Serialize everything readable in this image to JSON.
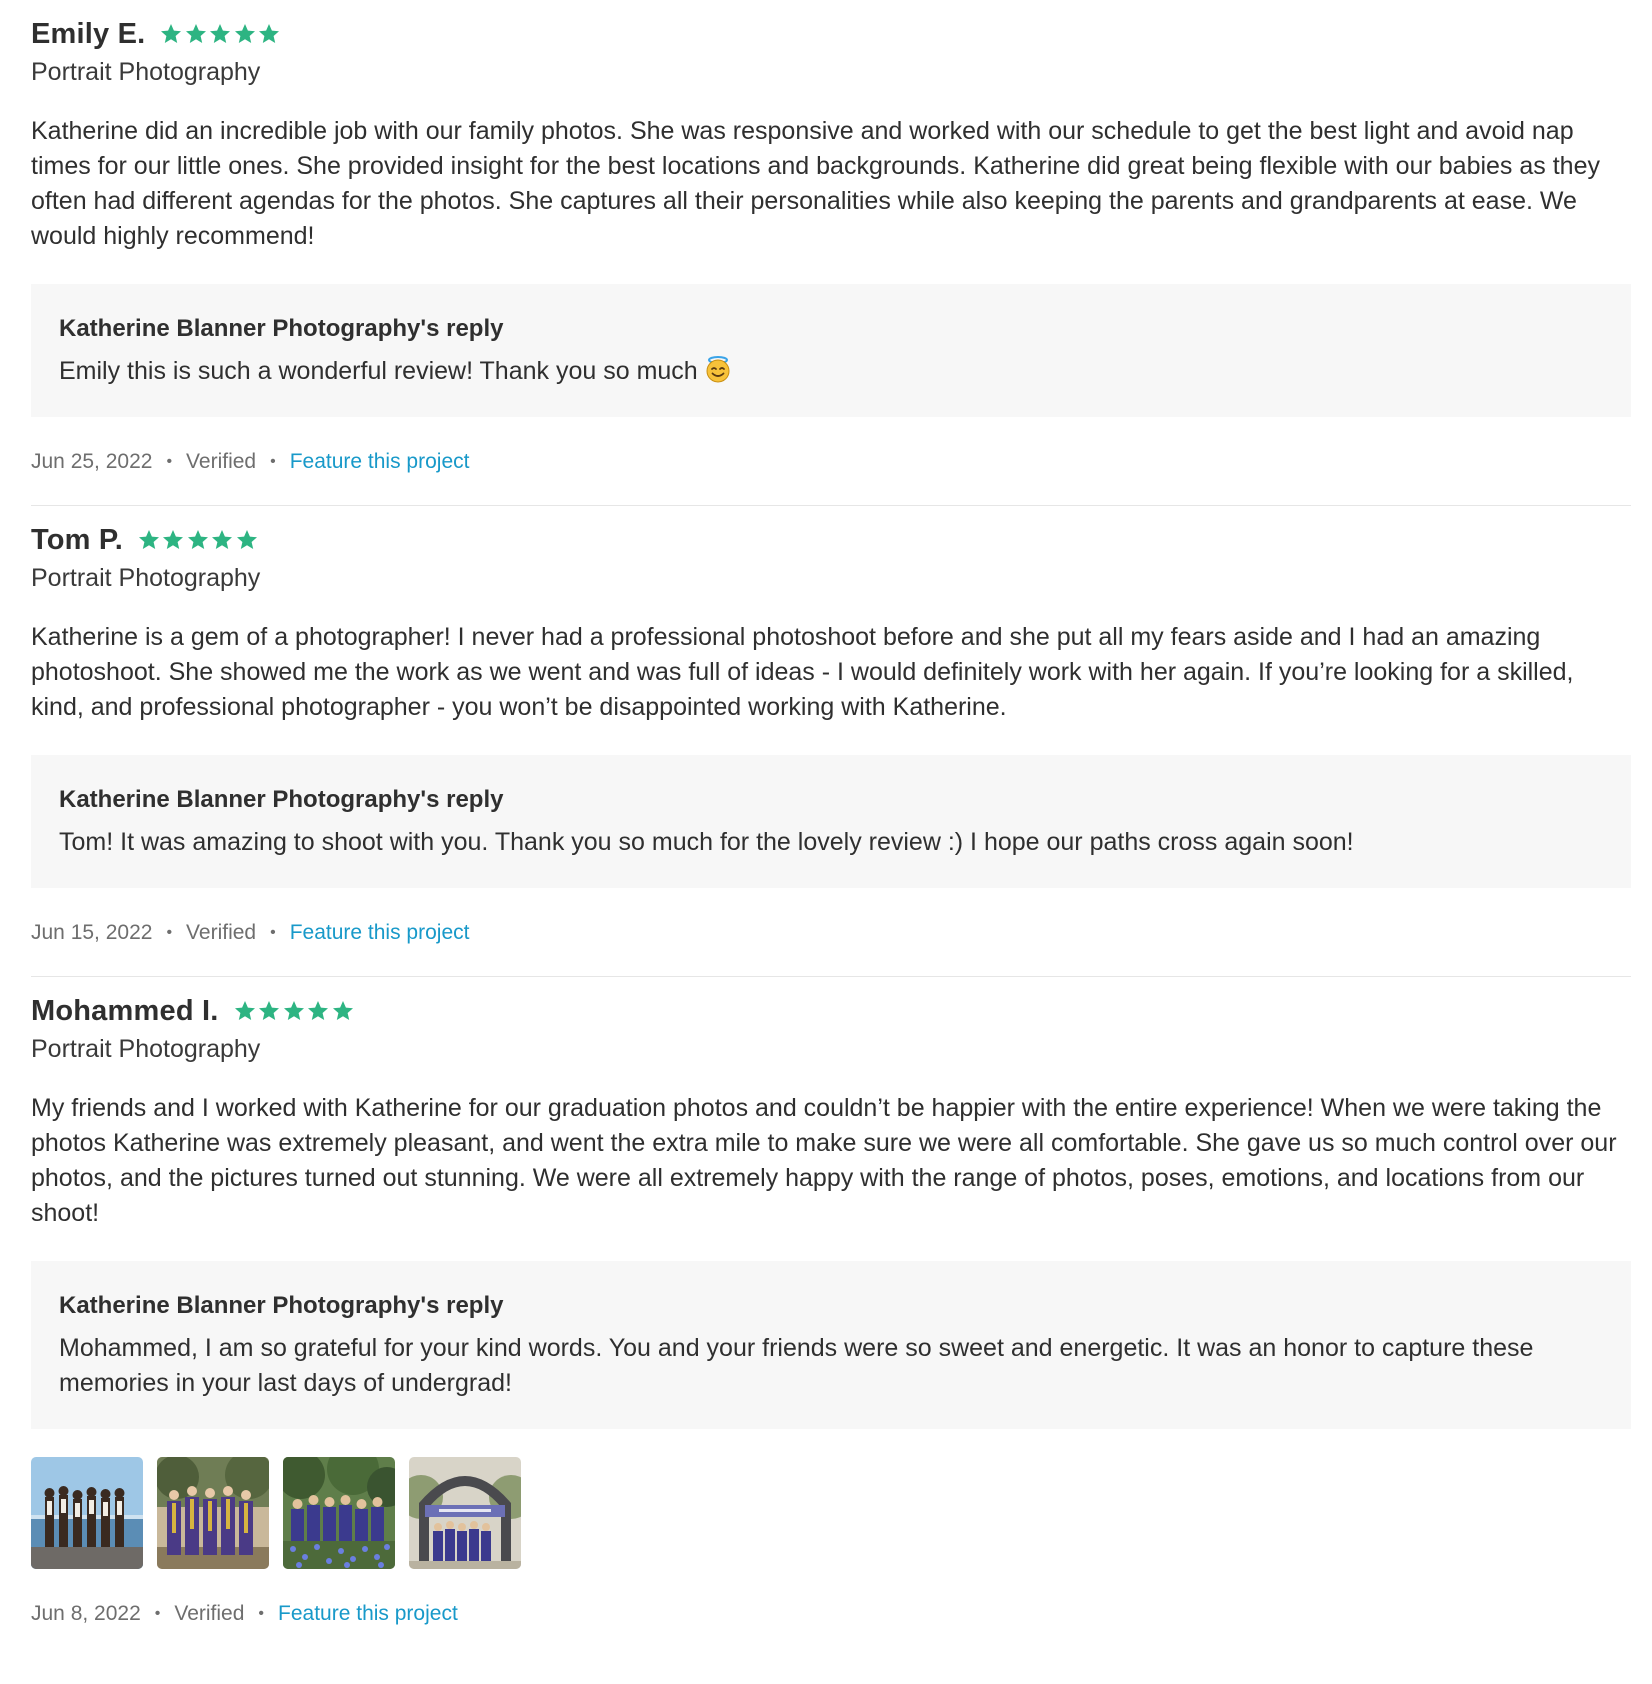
{
  "colors": {
    "star": "#2db482",
    "link": "#1899c9",
    "reply_bg": "#f7f7f7",
    "divider": "#e6e6e6"
  },
  "reviews": [
    {
      "name": "Emily E.",
      "rating": 5,
      "service": "Portrait Photography",
      "text": "Katherine did an incredible job with our family photos. She was responsive and worked with our schedule to get the best light and avoid nap times for our little ones. She provided insight for the best locations and backgrounds. Katherine did great being flexible with our babies as they often had different agendas for the photos. She captures all their personalities while also keeping the parents and grandparents at ease. We would highly recommend!",
      "reply_title": "Katherine Blanner Photography's reply",
      "reply_text": "Emily this is such a wonderful review! Thank you so much",
      "reply_emoji": "smiling-face-with-halo-icon",
      "date": "Jun 25, 2022",
      "verified": "Verified",
      "feature_label": "Feature this project"
    },
    {
      "name": "Tom P.",
      "rating": 5,
      "service": "Portrait Photography",
      "text": "Katherine is a gem of a photographer! I never had a professional photoshoot before and she put all my fears aside and I had an amazing photoshoot. She showed me the work as we went and was full of ideas - I would definitely work with her again. If you’re looking for a skilled, kind, and professional photographer - you won’t be disappointed working with Katherine.",
      "reply_title": "Katherine Blanner Photography's reply",
      "reply_text": "Tom! It was amazing to shoot with you. Thank you so much for the lovely review :) I hope our paths cross again soon!",
      "date": "Jun 15, 2022",
      "verified": "Verified",
      "feature_label": "Feature this project"
    },
    {
      "name": "Mohammed I.",
      "rating": 5,
      "service": "Portrait Photography",
      "text": "My friends and I worked with Katherine for our graduation photos and couldn’t be happier with the entire experience! When we were taking the photos Katherine was extremely pleasant, and went the extra mile to make sure we were all comfortable. She gave us so much control over our photos, and the pictures turned out stunning. We were all extremely happy with the range of photos, poses, emotions, and locations from our shoot!",
      "reply_title": "Katherine Blanner Photography's reply",
      "reply_text": "Mohammed, I am so grateful for your kind words. You and your friends were so sweet and energetic. It was an honor to capture these memories in your last days of undergrad!",
      "photos": [
        "group-by-lake-photo",
        "group-in-gowns-photo",
        "group-in-garden-photo",
        "group-under-arch-photo"
      ],
      "date": "Jun 8, 2022",
      "verified": "Verified",
      "feature_label": "Feature this project"
    }
  ]
}
